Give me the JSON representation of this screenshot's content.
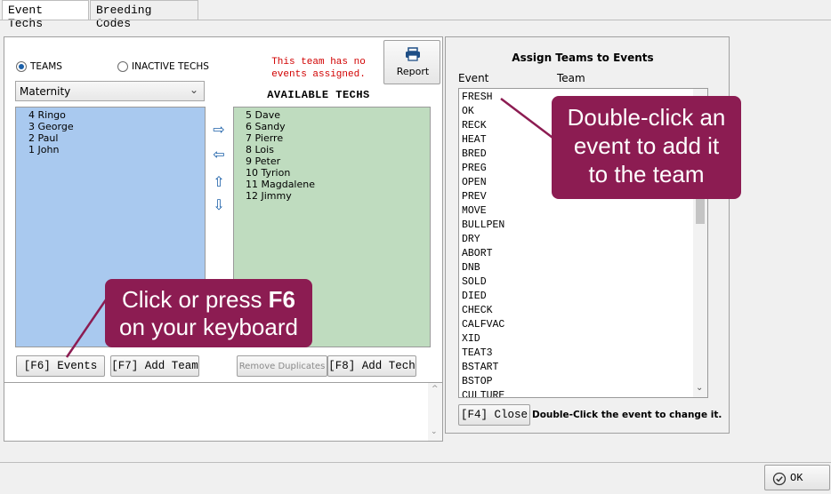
{
  "tabs": [
    {
      "label": "Event Techs"
    },
    {
      "label": "Breeding Codes"
    }
  ],
  "left": {
    "radio_teams": "TEAMS",
    "radio_inactive": "INACTIVE TECHS",
    "team_select": "Maternity",
    "warning": "This team has no events assigned.",
    "report_label": "Report",
    "available_header": "AVAILABLE TECHS",
    "team_members": [
      "4 Ringo",
      "3 George",
      "2 Paul",
      "1 John"
    ],
    "available_techs": [
      "5 Dave",
      "6 Sandy",
      "7 Pierre",
      "8 Lois",
      "9 Peter",
      "10 Tyrion",
      "11 Magdalene",
      "12 Jimmy"
    ],
    "buttons": {
      "events": "[F6] Events",
      "add_team": "[F7] Add Team",
      "remove_duplicates": "Remove Duplicates",
      "add_tech": "[F8] Add Tech"
    }
  },
  "right": {
    "title": "Assign Teams to Events",
    "col_event": "Event",
    "col_team": "Team",
    "events": [
      "FRESH",
      "OK",
      "RECK",
      "HEAT",
      "BRED",
      "PREG",
      "OPEN",
      "PREV",
      "MOVE",
      "BULLPEN",
      "DRY",
      "ABORT",
      "DNB",
      "SOLD",
      "DIED",
      "CHECK",
      "CALFVAC",
      "XID",
      "TEAT3",
      "BSTART",
      "BSTOP",
      "CULTURE"
    ],
    "close_label": "[F4] Close",
    "hint": "Double-Click the event to change it."
  },
  "callouts": {
    "events_tip_pre": "Click or press ",
    "events_tip_key": "F6",
    "events_tip_post": "on your keyboard",
    "dblclick_tip": "Double-click an event to add it to the team"
  },
  "footer": {
    "ok_label": "OK"
  },
  "colors": {
    "team_list_bg": "#a9c9ef",
    "available_list_bg": "#bfdcbf",
    "callout_bg": "#8c1c52",
    "warning_text": "#d10000"
  },
  "icons": {
    "transfer_right": "arrow-right-icon",
    "transfer_left": "arrow-left-icon",
    "move_up": "arrow-up-icon",
    "move_down": "arrow-down-icon",
    "printer": "printer-icon",
    "ok": "check-circle-icon"
  }
}
